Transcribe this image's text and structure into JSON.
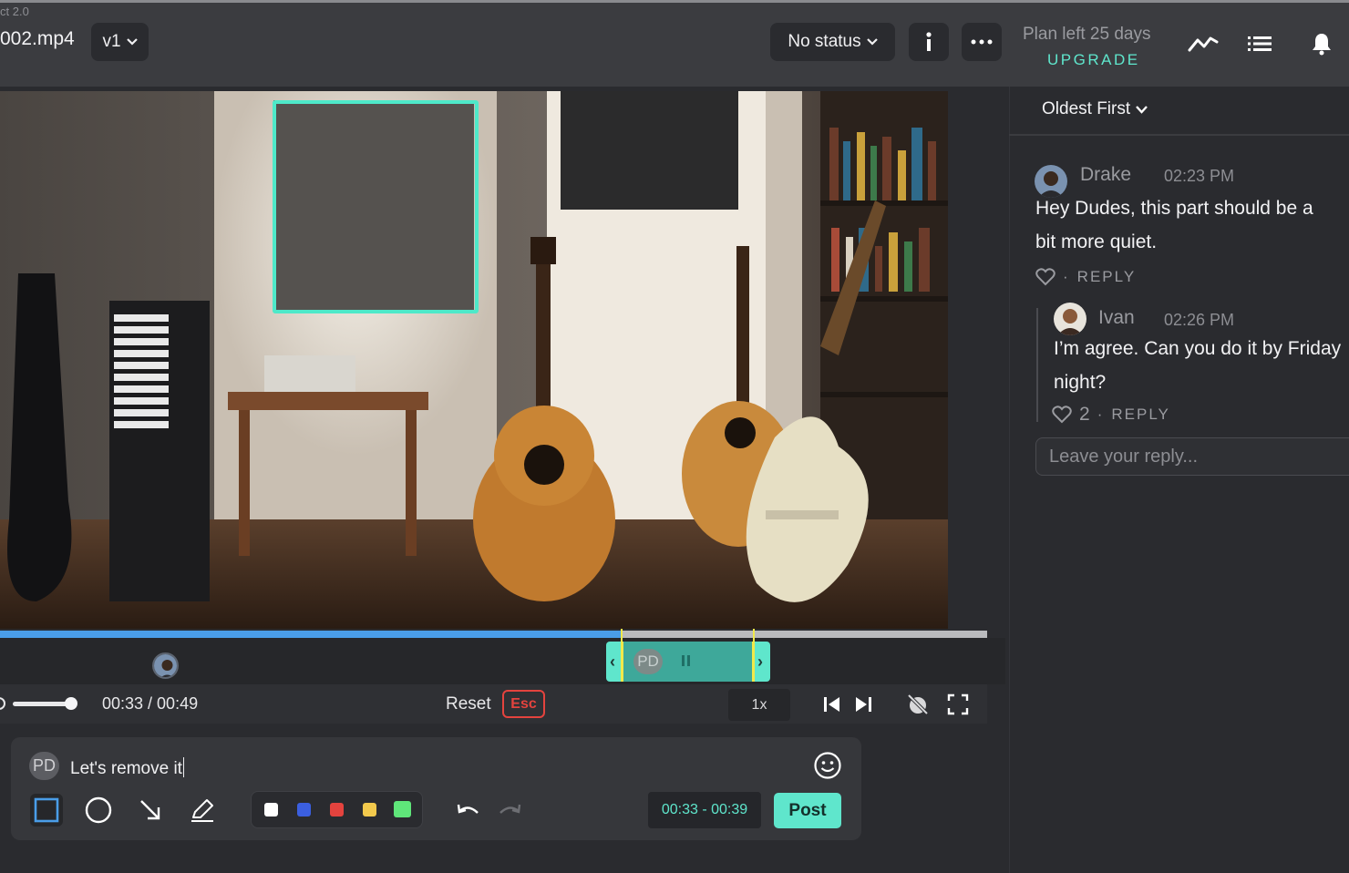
{
  "header": {
    "crumb": "ct 2.0",
    "filename": "002.mp4",
    "version": "v1",
    "status": "No status",
    "plan_text": "Plan left 25 days",
    "upgrade": "UPGRADE"
  },
  "timeline": {
    "played_fraction": 0.63,
    "range_avatar": "PD"
  },
  "player": {
    "time": "00:33 / 00:49",
    "volume": 1.0,
    "reset": "Reset",
    "esc": "Esc",
    "speed": "1x"
  },
  "composer": {
    "avatar": "PD",
    "text": "Let's remove it",
    "range_time": "00:33 - 00:39",
    "post": "Post",
    "colors": [
      "#ffffff",
      "#3b5fe0",
      "#e4433e",
      "#f2c94c",
      "#5fe67a"
    ]
  },
  "comments": {
    "sort": "Oldest First",
    "first": {
      "author": "Drake",
      "time": "02:23 PM",
      "line1": "Hey Dudes, this part should be a",
      "line2": "bit more quiet.",
      "reply": "REPLY"
    },
    "second": {
      "author": "Ivan",
      "time": "02:26 PM",
      "line1": "I’m agree. Can you do it by Friday",
      "line2": "night?",
      "likes": "2",
      "reply": "REPLY"
    },
    "reply_placeholder": "Leave your reply..."
  }
}
